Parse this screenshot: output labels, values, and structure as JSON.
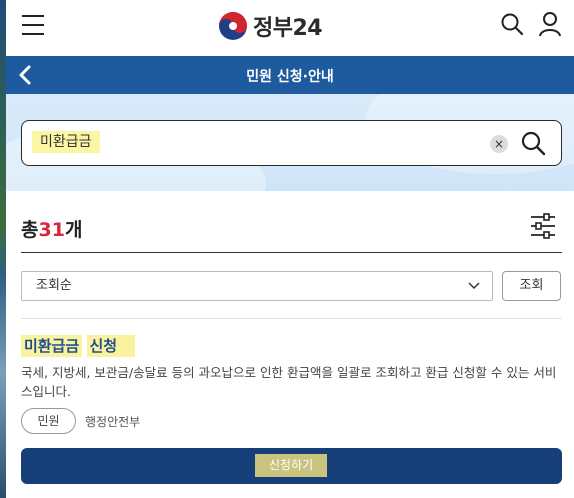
{
  "header": {
    "logo_text": "정부24",
    "menu_icon": "hamburger-menu-icon",
    "search_icon": "search-icon",
    "user_icon": "user-icon"
  },
  "titlebar": {
    "title": "민원 신청·안내",
    "back_icon": "chevron-left-icon"
  },
  "search": {
    "value": "미환급금",
    "clear_glyph": "×"
  },
  "results": {
    "total_prefix": "총",
    "total_count": "31",
    "total_suffix": "개",
    "sort_selected": "조회순",
    "lookup_label": "조회"
  },
  "items": [
    {
      "title_highlight": "미환급금",
      "title_rest": "신청",
      "description": "국세, 지방세, 보관금/송달료 등의 과오납으로 인한 환급액을 일괄로 조회하고 환급 신청할 수 있는 서비스입니다.",
      "badge": "민원",
      "department": "행정안전부",
      "apply_label": "신청하기"
    }
  ],
  "colors": {
    "brand_blue": "#1d5b9e",
    "apply_button": "#163f7a",
    "count_red": "#d7263d",
    "highlight": "#fbf2a0"
  }
}
